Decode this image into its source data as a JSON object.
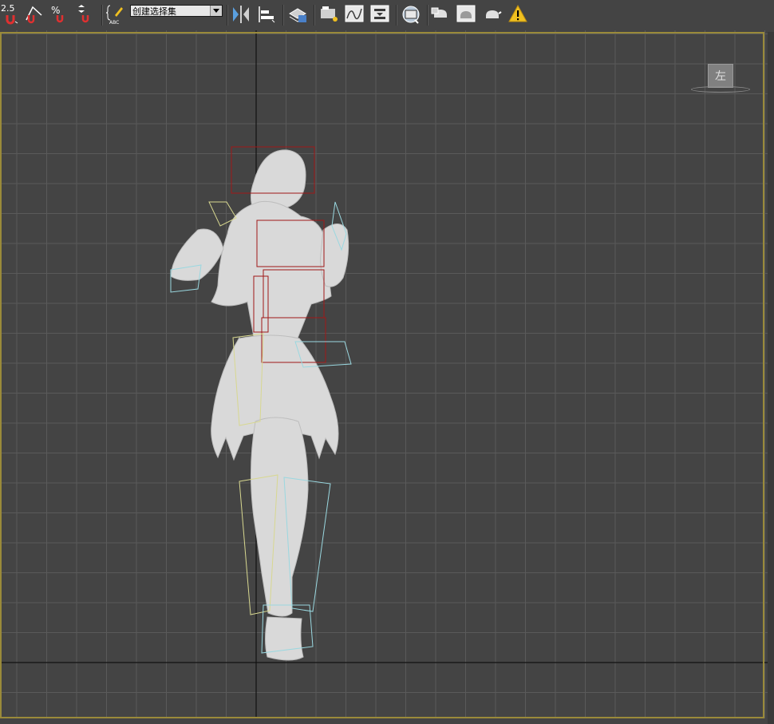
{
  "toolbar": {
    "snap_value": "2.5",
    "selection_set_value": "创建选择集",
    "buttons": [
      "angle-snap-icon",
      "percent-snap-icon",
      "spinner-snap-icon",
      "edit-named-selection-icon",
      "mirror-icon",
      "align-icon",
      "layer-manager-icon",
      "scene-explorer-icon",
      "curve-editor-icon",
      "schematic-view-icon",
      "material-editor-icon",
      "render-setup-icon",
      "rendered-frame-window-icon",
      "render-icon",
      "warning-icon"
    ]
  },
  "viewport": {
    "viewcube_label": "左",
    "grid_color": "#5a5a5a",
    "axis_color": "#111111",
    "frame_color": "#9a8a3a",
    "mesh_color": "#d9d9d9"
  }
}
